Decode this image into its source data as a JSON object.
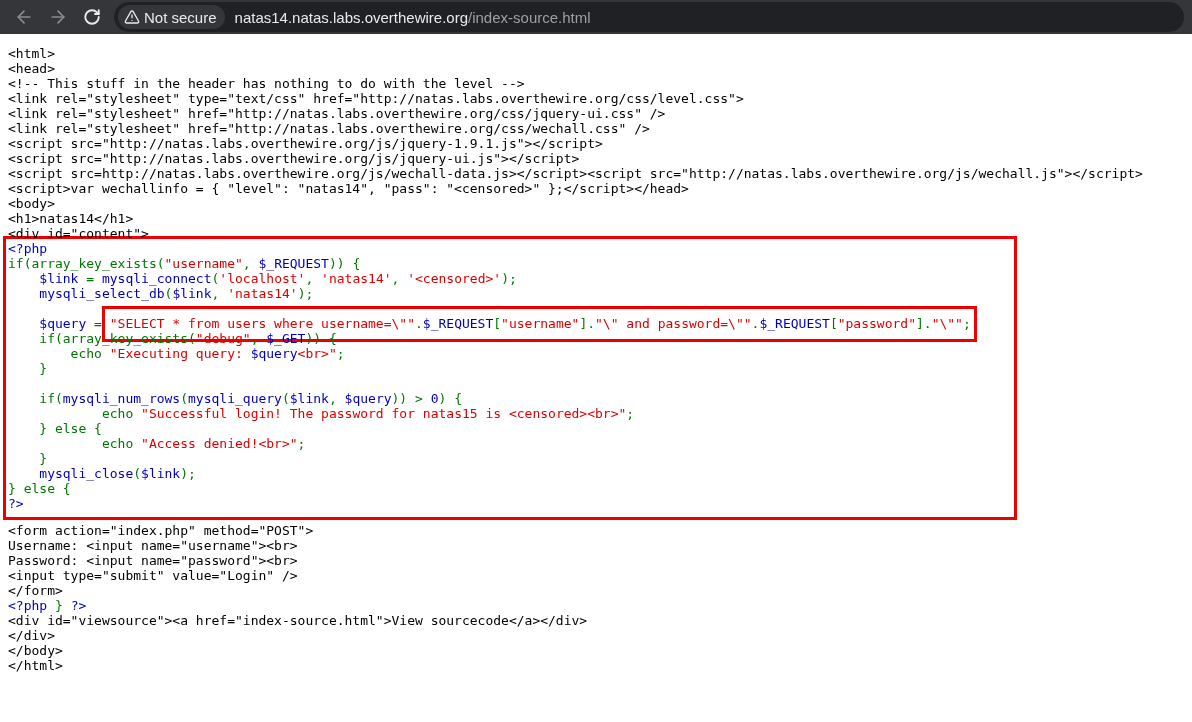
{
  "browser": {
    "back": {
      "disabled": true
    },
    "forward": {
      "disabled": true
    },
    "security_label": "Not secure",
    "url_host": "natas14.natas.labs.overthewire.org",
    "url_path": "/index-source.html"
  },
  "sections": [
    {
      "kind": "plain",
      "lines": [
        {
          "kind": "code",
          "segments": [
            {
              "kind": "html",
              "text": "<html>"
            }
          ]
        },
        {
          "kind": "code",
          "segments": [
            {
              "kind": "html",
              "text": "<head>"
            }
          ]
        },
        {
          "kind": "code",
          "segments": [
            {
              "kind": "html",
              "text": "<!-- This stuff in the header has nothing to do with the level -->"
            }
          ]
        },
        {
          "kind": "code",
          "segments": [
            {
              "kind": "html",
              "text": "<link rel=\"stylesheet\" type=\"text/css\" href=\"http://natas.labs.overthewire.org/css/level.css\">"
            }
          ]
        },
        {
          "kind": "code",
          "segments": [
            {
              "kind": "html",
              "text": "<link rel=\"stylesheet\" href=\"http://natas.labs.overthewire.org/css/jquery-ui.css\" />"
            }
          ]
        },
        {
          "kind": "code",
          "segments": [
            {
              "kind": "html",
              "text": "<link rel=\"stylesheet\" href=\"http://natas.labs.overthewire.org/css/wechall.css\" />"
            }
          ]
        },
        {
          "kind": "code",
          "segments": [
            {
              "kind": "html",
              "text": "<script src=\"http://natas.labs.overthewire.org/js/jquery-1.9.1.js\"></script>"
            }
          ]
        },
        {
          "kind": "code",
          "segments": [
            {
              "kind": "html",
              "text": "<script src=\"http://natas.labs.overthewire.org/js/jquery-ui.js\"></script>"
            }
          ]
        },
        {
          "kind": "code",
          "segments": [
            {
              "kind": "html",
              "text": "<script src=http://natas.labs.overthewire.org/js/wechall-data.js></script><script src=\"http://natas.labs.overthewire.org/js/wechall.js\"></script>"
            }
          ]
        },
        {
          "kind": "code",
          "segments": [
            {
              "kind": "html",
              "text": "<script>var wechallinfo = { \"level\": \"natas14\", \"pass\": \"<censored>\" };</script></head>"
            }
          ]
        },
        {
          "kind": "code",
          "segments": [
            {
              "kind": "html",
              "text": "<body>"
            }
          ]
        },
        {
          "kind": "code",
          "segments": [
            {
              "kind": "html",
              "text": "<h1>natas14</h1>"
            }
          ]
        },
        {
          "kind": "code",
          "segments": [
            {
              "kind": "html",
              "text": "<div id=\"content\">"
            }
          ]
        }
      ]
    },
    {
      "kind": "framed",
      "lines": [
        {
          "kind": "code",
          "segments": [
            {
              "kind": "default",
              "text": "<?php"
            }
          ]
        },
        {
          "kind": "code",
          "segments": [
            {
              "kind": "keyword",
              "text": "if(array_key_exists("
            },
            {
              "kind": "string",
              "text": "\"username\""
            },
            {
              "kind": "keyword",
              "text": ", "
            },
            {
              "kind": "default",
              "text": "$_REQUEST"
            },
            {
              "kind": "keyword",
              "text": ")) {"
            }
          ]
        },
        {
          "kind": "code",
          "segments": [
            {
              "kind": "default",
              "text": "    $link "
            },
            {
              "kind": "keyword",
              "text": "= "
            },
            {
              "kind": "default",
              "text": "mysqli_connect"
            },
            {
              "kind": "keyword",
              "text": "("
            },
            {
              "kind": "string",
              "text": "'localhost'"
            },
            {
              "kind": "keyword",
              "text": ", "
            },
            {
              "kind": "string",
              "text": "'natas14'"
            },
            {
              "kind": "keyword",
              "text": ", "
            },
            {
              "kind": "string",
              "text": "'<censored>'"
            },
            {
              "kind": "keyword",
              "text": ");"
            }
          ]
        },
        {
          "kind": "code",
          "segments": [
            {
              "kind": "default",
              "text": "    mysqli_select_db"
            },
            {
              "kind": "keyword",
              "text": "("
            },
            {
              "kind": "default",
              "text": "$link"
            },
            {
              "kind": "keyword",
              "text": ", "
            },
            {
              "kind": "string",
              "text": "'natas14'"
            },
            {
              "kind": "keyword",
              "text": ");"
            }
          ]
        },
        {
          "kind": "blank"
        },
        {
          "kind": "code",
          "segments": [
            {
              "kind": "default",
              "text": "    $query "
            },
            {
              "kind": "keyword",
              "text": "= "
            }
          ],
          "boxed_segments": [
            {
              "kind": "string",
              "text": "\"SELECT * from users where username=\\\"\""
            },
            {
              "kind": "keyword",
              "text": "."
            },
            {
              "kind": "default",
              "text": "$_REQUEST"
            },
            {
              "kind": "keyword",
              "text": "["
            },
            {
              "kind": "string",
              "text": "\"username\""
            },
            {
              "kind": "keyword",
              "text": "]."
            },
            {
              "kind": "string",
              "text": "\"\\\" and password=\\\"\""
            },
            {
              "kind": "keyword",
              "text": "."
            },
            {
              "kind": "default",
              "text": "$_REQUEST"
            },
            {
              "kind": "keyword",
              "text": "["
            },
            {
              "kind": "string",
              "text": "\"password\""
            },
            {
              "kind": "keyword",
              "text": "]."
            },
            {
              "kind": "string",
              "text": "\"\\\"\""
            },
            {
              "kind": "keyword",
              "text": ";"
            }
          ]
        },
        {
          "kind": "code",
          "segments": [
            {
              "kind": "keyword",
              "text": "    if(array_key_exists("
            },
            {
              "kind": "string",
              "text": "\"debug\""
            },
            {
              "kind": "keyword",
              "text": ", "
            },
            {
              "kind": "default",
              "text": "$_GET"
            },
            {
              "kind": "keyword",
              "text": ")) {"
            }
          ]
        },
        {
          "kind": "code",
          "segments": [
            {
              "kind": "keyword",
              "text": "        echo "
            },
            {
              "kind": "string",
              "text": "\"Executing query: "
            },
            {
              "kind": "default",
              "text": "$query"
            },
            {
              "kind": "string",
              "text": "<br>\""
            },
            {
              "kind": "keyword",
              "text": ";"
            }
          ]
        },
        {
          "kind": "code",
          "segments": [
            {
              "kind": "keyword",
              "text": "    }"
            }
          ]
        },
        {
          "kind": "blank"
        },
        {
          "kind": "code",
          "segments": [
            {
              "kind": "keyword",
              "text": "    if("
            },
            {
              "kind": "default",
              "text": "mysqli_num_rows"
            },
            {
              "kind": "keyword",
              "text": "("
            },
            {
              "kind": "default",
              "text": "mysqli_query"
            },
            {
              "kind": "keyword",
              "text": "("
            },
            {
              "kind": "default",
              "text": "$link"
            },
            {
              "kind": "keyword",
              "text": ", "
            },
            {
              "kind": "default",
              "text": "$query"
            },
            {
              "kind": "keyword",
              "text": ")) > "
            },
            {
              "kind": "default",
              "text": "0"
            },
            {
              "kind": "keyword",
              "text": ") {"
            }
          ]
        },
        {
          "kind": "code",
          "segments": [
            {
              "kind": "keyword",
              "text": "            echo "
            },
            {
              "kind": "string",
              "text": "\"Successful login! The password for natas15 is <censored><br>\""
            },
            {
              "kind": "keyword",
              "text": ";"
            }
          ]
        },
        {
          "kind": "code",
          "segments": [
            {
              "kind": "keyword",
              "text": "    } else {"
            }
          ]
        },
        {
          "kind": "code",
          "segments": [
            {
              "kind": "keyword",
              "text": "            echo "
            },
            {
              "kind": "string",
              "text": "\"Access denied!<br>\""
            },
            {
              "kind": "keyword",
              "text": ";"
            }
          ]
        },
        {
          "kind": "code",
          "segments": [
            {
              "kind": "keyword",
              "text": "    }"
            }
          ]
        },
        {
          "kind": "code",
          "segments": [
            {
              "kind": "default",
              "text": "    mysqli_close"
            },
            {
              "kind": "keyword",
              "text": "("
            },
            {
              "kind": "default",
              "text": "$link"
            },
            {
              "kind": "keyword",
              "text": ");"
            }
          ]
        },
        {
          "kind": "code",
          "segments": [
            {
              "kind": "keyword",
              "text": "} else {"
            }
          ]
        },
        {
          "kind": "code",
          "segments": [
            {
              "kind": "default",
              "text": "?>"
            }
          ]
        }
      ]
    },
    {
      "kind": "plain",
      "lines": [
        {
          "kind": "code",
          "segments": [
            {
              "kind": "html",
              "text": "<form action=\"index.php\" method=\"POST\">"
            }
          ]
        },
        {
          "kind": "code",
          "segments": [
            {
              "kind": "html",
              "text": "Username: <input name=\"username\"><br>"
            }
          ]
        },
        {
          "kind": "code",
          "segments": [
            {
              "kind": "html",
              "text": "Password: <input name=\"password\"><br>"
            }
          ]
        },
        {
          "kind": "code",
          "segments": [
            {
              "kind": "html",
              "text": "<input type=\"submit\" value=\"Login\" />"
            }
          ]
        },
        {
          "kind": "code",
          "segments": [
            {
              "kind": "html",
              "text": "</form>"
            }
          ]
        },
        {
          "kind": "code",
          "segments": [
            {
              "kind": "default",
              "text": "<?php "
            },
            {
              "kind": "keyword",
              "text": "} "
            },
            {
              "kind": "default",
              "text": "?>"
            }
          ]
        },
        {
          "kind": "code",
          "segments": [
            {
              "kind": "html",
              "text": "<div id=\"viewsource\"><a href=\"index-source.html\">View sourcecode</a></div>"
            }
          ]
        },
        {
          "kind": "code",
          "segments": [
            {
              "kind": "html",
              "text": "</div>"
            }
          ]
        },
        {
          "kind": "code",
          "segments": [
            {
              "kind": "html",
              "text": "</body>"
            }
          ]
        },
        {
          "kind": "code",
          "segments": [
            {
              "kind": "html",
              "text": "</html>"
            }
          ]
        }
      ]
    }
  ]
}
